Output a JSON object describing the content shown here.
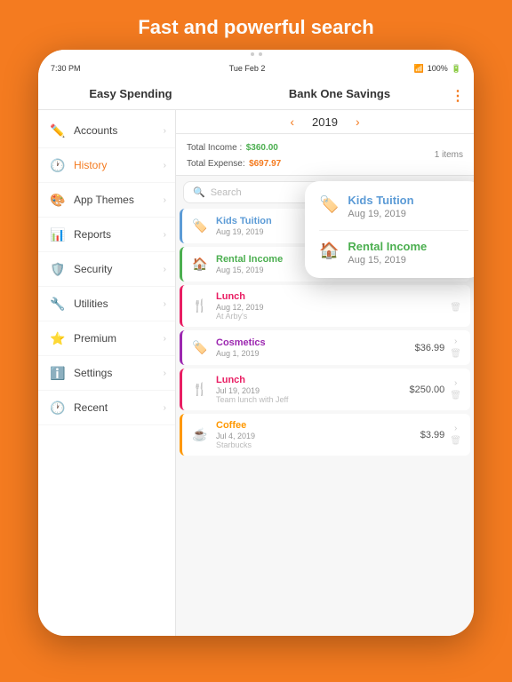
{
  "hero": {
    "title": "Fast and powerful search"
  },
  "statusBar": {
    "time": "7:30 PM",
    "date": "Tue Feb 2",
    "wifi": "WiFi",
    "battery": "100%"
  },
  "header": {
    "appName": "Easy Spending",
    "accountName": "Bank One Savings"
  },
  "yearNav": {
    "year": "2019",
    "prevArrow": "‹",
    "nextArrow": "›"
  },
  "summary": {
    "incomeLabel": "Total Income :",
    "incomeValue": "$360.00",
    "expenseLabel": "Total Expense:",
    "expenseValue": "$697.97",
    "itemsCount": "1 items"
  },
  "search": {
    "placeholder": "Search"
  },
  "sidebar": {
    "items": [
      {
        "id": "accounts",
        "label": "Accounts",
        "icon": "✏️"
      },
      {
        "id": "history",
        "label": "History",
        "icon": "🕐",
        "active": true
      },
      {
        "id": "app-themes",
        "label": "App Themes",
        "icon": "🎨"
      },
      {
        "id": "reports",
        "label": "Reports",
        "icon": "📊"
      },
      {
        "id": "security",
        "label": "Security",
        "icon": "🛡️"
      },
      {
        "id": "utilities",
        "label": "Utilities",
        "icon": "🔧"
      },
      {
        "id": "premium",
        "label": "Premium",
        "icon": "⭐"
      },
      {
        "id": "settings",
        "label": "Settings",
        "icon": "ℹ️"
      },
      {
        "id": "recent",
        "label": "Recent",
        "icon": "🕐"
      }
    ]
  },
  "transactions": [
    {
      "id": "kids-tuition",
      "name": "Kids Tuition",
      "date": "Aug 19, 2019",
      "sub": "",
      "amount": "",
      "colorClass": "kids",
      "nameClass": "",
      "icon": "🏷️"
    },
    {
      "id": "rental-income",
      "name": "Rental Income",
      "date": "Aug 15, 2019",
      "sub": "",
      "amount": "",
      "colorClass": "rental",
      "nameClass": "green",
      "icon": "🏠"
    },
    {
      "id": "lunch",
      "name": "Lunch",
      "date": "Aug 12, 2019",
      "sub": "At Arby's",
      "amount": "",
      "colorClass": "lunch",
      "nameClass": "red",
      "icon": "🍴"
    },
    {
      "id": "cosmetics",
      "name": "Cosmetics",
      "date": "Aug 1, 2019",
      "sub": "",
      "amount": "$36.99",
      "colorClass": "cosmetics",
      "nameClass": "purple",
      "icon": "🏷️"
    },
    {
      "id": "lunch2",
      "name": "Lunch",
      "date": "Jul 19, 2019",
      "sub": "Team lunch with Jeff",
      "amount": "$250.00",
      "colorClass": "lunch2",
      "nameClass": "red",
      "icon": "🍴"
    },
    {
      "id": "coffee",
      "name": "Coffee",
      "date": "Jul 4, 2019",
      "sub": "Starbucks",
      "amount": "$3.99",
      "colorClass": "coffee",
      "nameClass": "orange",
      "icon": "☕"
    }
  ],
  "tooltip": {
    "items": [
      {
        "id": "kids-tuition-tip",
        "name": "Kids Tuition",
        "date": "Aug 19, 2019",
        "icon": "🏷️",
        "nameClass": ""
      },
      {
        "id": "rental-income-tip",
        "name": "Rental Income",
        "date": "Aug 15, 2019",
        "icon": "🏠",
        "nameClass": "green"
      }
    ]
  }
}
